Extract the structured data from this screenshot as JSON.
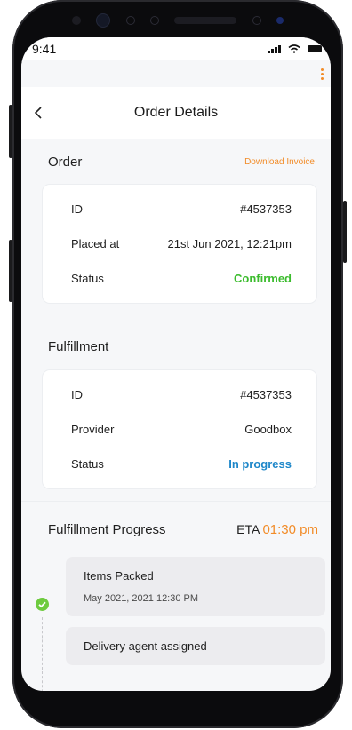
{
  "status_bar": {
    "time": "9:41"
  },
  "header": {
    "title": "Order Details"
  },
  "order": {
    "section_title": "Order",
    "download_label": "Download Invoice",
    "rows": [
      {
        "label": "ID",
        "value": "#4537353"
      },
      {
        "label": "Placed at",
        "value": "21st Jun 2021, 12:21pm"
      },
      {
        "label": "Status",
        "value": "Confirmed"
      }
    ]
  },
  "fulfillment": {
    "section_title": "Fulfillment",
    "rows": [
      {
        "label": "ID",
        "value": "#4537353"
      },
      {
        "label": "Provider",
        "value": "Goodbox"
      },
      {
        "label": "Status",
        "value": "In progress"
      }
    ]
  },
  "progress": {
    "section_title": "Fulfillment Progress",
    "eta_label": "ETA",
    "eta_time": "01:30 pm",
    "steps": [
      {
        "title": "Items Packed",
        "time": "May 2021, 2021 12:30 PM"
      },
      {
        "title": "Delivery agent assigned",
        "time": ""
      }
    ]
  },
  "colors": {
    "accent": "#f28c28",
    "confirmed": "#3cbc2e",
    "in_progress": "#1e87c9",
    "step_done": "#6ecb3f"
  }
}
